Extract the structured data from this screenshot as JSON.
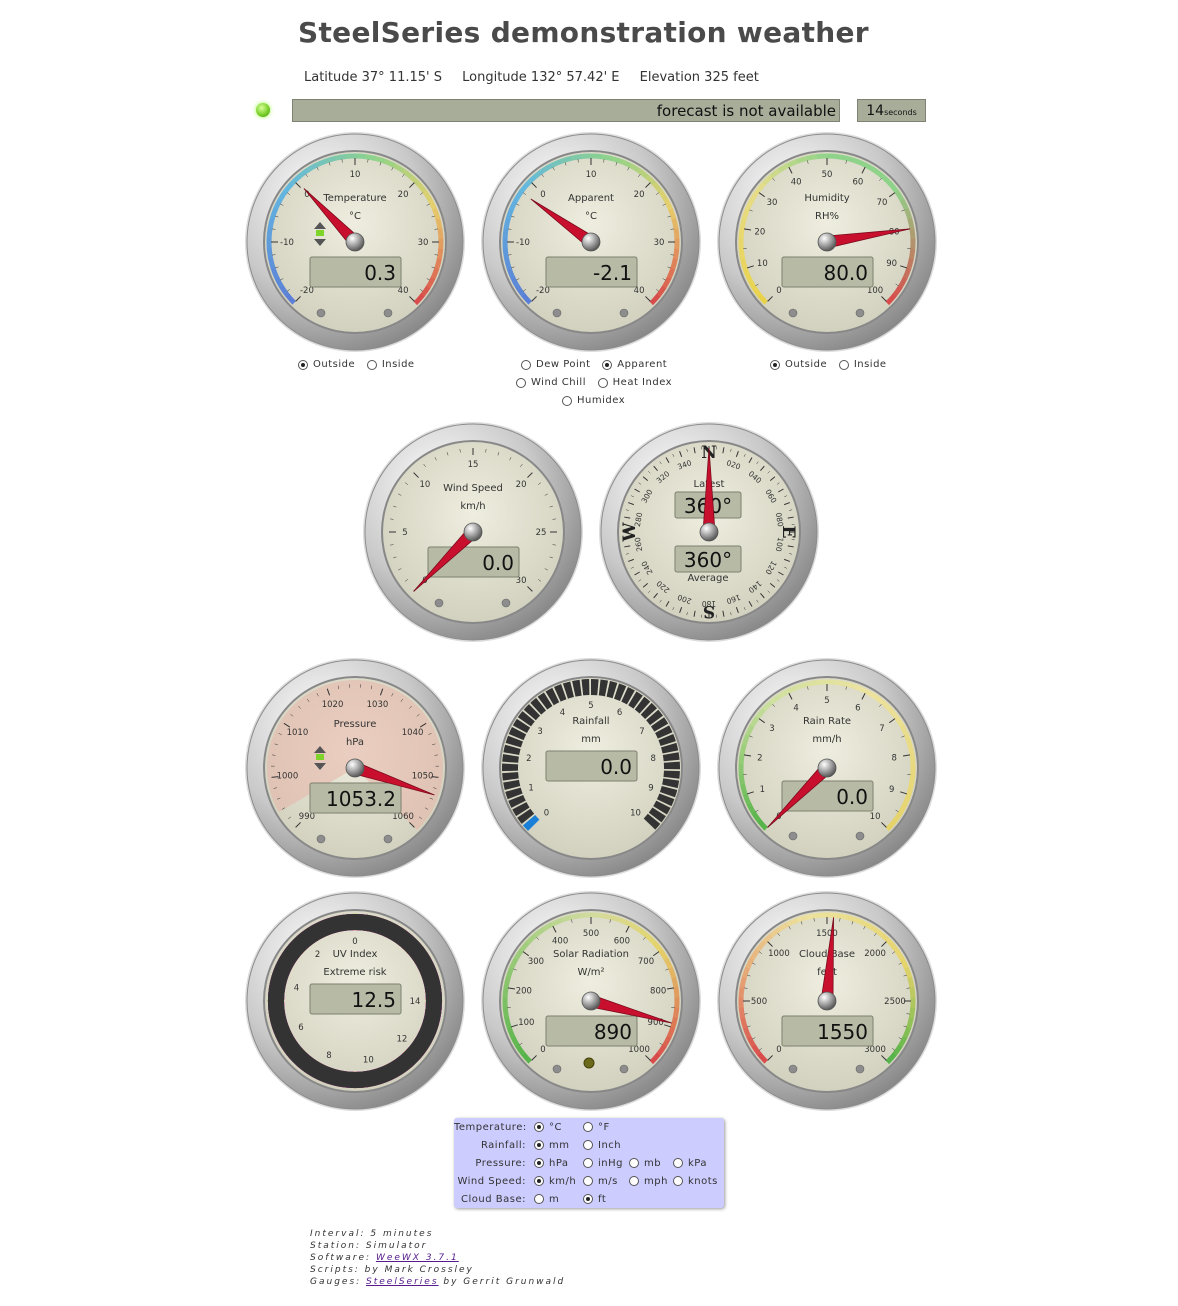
{
  "header": {
    "title": "SteelSeries demonstration weather",
    "latitude": "Latitude 37° 11.15' S",
    "longitude": "Longitude 132° 57.42' E",
    "elevation": "Elevation 325 feet"
  },
  "status": {
    "message": "forecast is not available",
    "timer_value": "14",
    "timer_unit": "seconds"
  },
  "gauges": {
    "temperature": {
      "title": "Temperature",
      "unit": "°C",
      "value": "0.3",
      "ticks": [
        "-20",
        "-10",
        "0",
        "10",
        "20",
        "30",
        "40"
      ]
    },
    "apparent": {
      "title": "Apparent",
      "unit": "°C",
      "value": "-2.1",
      "ticks": [
        "-20",
        "-10",
        "0",
        "10",
        "20",
        "30",
        "40"
      ]
    },
    "humidity": {
      "title": "Humidity",
      "unit": "RH%",
      "value": "80.0",
      "ticks": [
        "0",
        "10",
        "20",
        "30",
        "40",
        "50",
        "60",
        "70",
        "80",
        "90",
        "100"
      ]
    },
    "wind_speed": {
      "title": "Wind Speed",
      "unit": "km/h",
      "value": "0.0",
      "ticks": [
        "0",
        "5",
        "10",
        "15",
        "20",
        "25",
        "30"
      ]
    },
    "wind_direction": {
      "latest_label": "Latest",
      "latest": "360°",
      "average_label": "Average",
      "average": "360°",
      "letters": [
        "N",
        "E",
        "S",
        "W"
      ],
      "degrees": [
        "020",
        "040",
        "060",
        "080",
        "100",
        "120",
        "140",
        "160",
        "180",
        "200",
        "220",
        "240",
        "260",
        "280",
        "300",
        "320",
        "340"
      ]
    },
    "pressure": {
      "title": "Pressure",
      "unit": "hPa",
      "value": "1053.2",
      "ticks": [
        "990",
        "1000",
        "1010",
        "1020",
        "1030",
        "1040",
        "1050",
        "1060"
      ]
    },
    "rainfall": {
      "title": "Rainfall",
      "unit": "mm",
      "value": "0.0",
      "ticks": [
        "0",
        "1",
        "2",
        "3",
        "4",
        "5",
        "6",
        "7",
        "8",
        "9",
        "10"
      ]
    },
    "rain_rate": {
      "title": "Rain Rate",
      "unit": "mm/h",
      "value": "0.0",
      "ticks": [
        "0",
        "1",
        "2",
        "3",
        "4",
        "5",
        "6",
        "7",
        "8",
        "9",
        "10"
      ]
    },
    "uv": {
      "title": "UV Index",
      "subtitle": "Extreme risk",
      "value": "12.5",
      "ticks": [
        "0",
        "2",
        "4",
        "6",
        "8",
        "10",
        "12",
        "14"
      ]
    },
    "solar": {
      "title": "Solar Radiation",
      "unit": "W/m²",
      "value": "890",
      "ticks": [
        "0",
        "100",
        "200",
        "300",
        "400",
        "500",
        "600",
        "700",
        "800",
        "900",
        "1000"
      ]
    },
    "cloud_base": {
      "title": "Cloud Base",
      "unit": "feet",
      "value": "1550",
      "ticks": [
        "0",
        "500",
        "1000",
        "1500",
        "2000",
        "2500",
        "3000"
      ]
    }
  },
  "temp_selector": {
    "outside": "Outside",
    "inside": "Inside"
  },
  "apparent_selector": {
    "dew_point": "Dew Point",
    "apparent": "Apparent",
    "wind_chill": "Wind Chill",
    "heat_index": "Heat Index",
    "humidex": "Humidex"
  },
  "humidity_selector": {
    "outside": "Outside",
    "inside": "Inside"
  },
  "units_panel": {
    "temperature_label": "Temperature:",
    "temp_c": "°C",
    "temp_f": "°F",
    "rainfall_label": "Rainfall:",
    "rain_mm": "mm",
    "rain_inch": "Inch",
    "pressure_label": "Pressure:",
    "press_hpa": "hPa",
    "press_inhg": "inHg",
    "press_mb": "mb",
    "press_kpa": "kPa",
    "wind_label": "Wind Speed:",
    "wind_kmh": "km/h",
    "wind_ms": "m/s",
    "wind_mph": "mph",
    "wind_knots": "knots",
    "cloud_label": "Cloud Base:",
    "cloud_m": "m",
    "cloud_ft": "ft"
  },
  "footer": {
    "interval": "Interval: 5 minutes",
    "station": "Station: Simulator",
    "software_prefix": "Software: ",
    "software_link": "WeeWX 3.7.1",
    "scripts": "Scripts: by Mark Crossley",
    "gauges_prefix": "Gauges: ",
    "gauges_link": "SteelSeries",
    "gauges_suffix": " by Gerrit Grunwald"
  }
}
